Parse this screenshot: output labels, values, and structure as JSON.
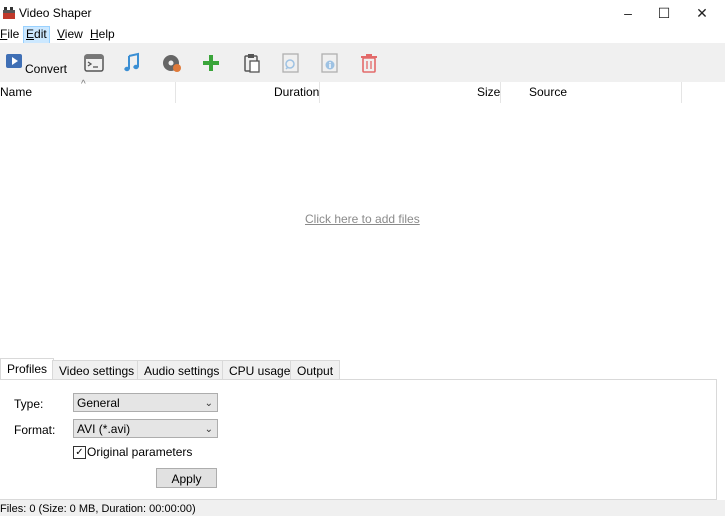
{
  "window": {
    "title": "Video Shaper",
    "controls": {
      "minimize": "–",
      "maximize": "☐",
      "close": "✕"
    }
  },
  "menu": [
    {
      "label": "File",
      "accel": "F",
      "rest": "ile"
    },
    {
      "label": "Edit",
      "accel": "E",
      "rest": "dit"
    },
    {
      "label": "View",
      "accel": "V",
      "rest": "iew"
    },
    {
      "label": "Help",
      "accel": "H",
      "rest": "elp"
    }
  ],
  "toolbar": {
    "convert_label": "Convert",
    "icons": [
      "convert-icon",
      "console-icon",
      "music-icon",
      "disc-icon",
      "add-icon",
      "paste-icon",
      "preview-icon",
      "info-icon",
      "delete-icon"
    ],
    "colors": {
      "music": "#3b8fd4",
      "add": "#3aa53a",
      "delete": "#e36a6a",
      "disabled": "#9ec2e3"
    }
  },
  "file_list": {
    "columns": [
      "Name",
      "Duration",
      "Size",
      "Source"
    ],
    "sort_indicator": "^",
    "empty_link": "Click here to add files"
  },
  "tabs": [
    "Profiles",
    "Video settings",
    "Audio settings",
    "CPU usage",
    "Output"
  ],
  "profiles": {
    "type_label": "Type:",
    "type_value": "General",
    "format_label": "Format:",
    "format_value": "AVI (*.avi)",
    "original_params_label": "Original parameters",
    "original_params_checked": true,
    "apply_label": "Apply"
  },
  "status": {
    "text": "Files: 0 (Size: 0 MB, Duration: 00:00:00)"
  }
}
